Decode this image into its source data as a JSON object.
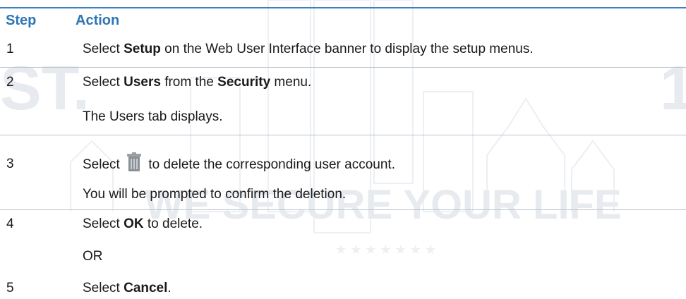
{
  "watermark": {
    "line1": "ST.",
    "line2": "WE SECURE YOUR LIFE",
    "stars": "★ ★ ★ ★ ★ ★ ★",
    "right_fragment": "1"
  },
  "table": {
    "headers": {
      "step": "Step",
      "action": "Action"
    },
    "rows": [
      {
        "step": "1",
        "lines": [
          {
            "pre": "Select ",
            "bold": "Setup",
            "post": " on the Web User Interface banner to display the setup menus."
          }
        ]
      },
      {
        "step": "2",
        "lines": [
          {
            "pre": "Select ",
            "bold": "Users",
            "mid": " from the ",
            "bold2": "Security",
            "post": " menu."
          },
          {
            "text": "The Users tab displays."
          }
        ]
      },
      {
        "step": "3",
        "lines": [
          {
            "pre": "Select ",
            "icon": "trash-icon",
            "post": " to delete the corresponding user account."
          },
          {
            "text": "You will be prompted to confirm the deletion."
          }
        ]
      },
      {
        "step": "4",
        "lines": [
          {
            "pre": "Select ",
            "bold": "OK",
            "post": " to delete."
          },
          {
            "text": "OR"
          }
        ]
      },
      {
        "step": "5",
        "lines": [
          {
            "pre": "Select ",
            "bold": "Cancel",
            "post": "."
          }
        ]
      }
    ]
  }
}
